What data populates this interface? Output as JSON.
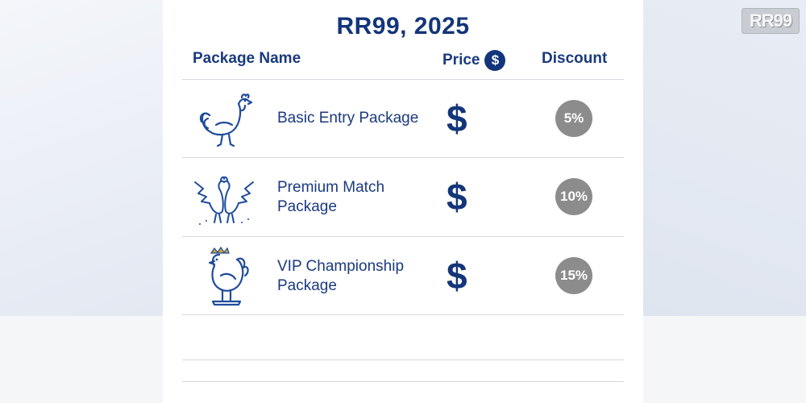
{
  "title": "RR99, 2025",
  "logo_text": "RR99",
  "headers": {
    "name": "Package Name",
    "price": "Price",
    "price_icon": "$",
    "discount": "Discount"
  },
  "rows": [
    {
      "name": "Basic Entry Package",
      "price_symbol": "$",
      "discount": "5%",
      "icon": "rooster-icon"
    },
    {
      "name": "Premium Match Package",
      "price_symbol": "$",
      "discount": "10%",
      "icon": "fighting-roosters-icon"
    },
    {
      "name": "VIP Championship Package",
      "price_symbol": "$",
      "discount": "15%",
      "icon": "crowned-rooster-icon"
    }
  ],
  "colors": {
    "primary": "#13357a",
    "discount_badge": "#8c8c8c"
  }
}
